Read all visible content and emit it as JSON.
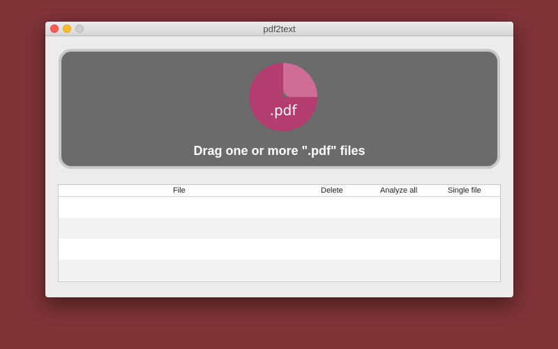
{
  "window": {
    "title": "pdf2text"
  },
  "dropzone": {
    "icon": "pdf-document-icon",
    "icon_label": ".pdf",
    "instruction": "Drag one or more \".pdf\" files",
    "colors": {
      "panel": "#6b6b6b",
      "icon_main": "#b33d6f",
      "icon_fold": "#cf6d97"
    }
  },
  "table": {
    "columns": [
      "File",
      "Delete",
      "Analyze all",
      "Single file"
    ],
    "rows": []
  },
  "colors": {
    "desktop": "#7e3337",
    "window": "#ececec"
  }
}
